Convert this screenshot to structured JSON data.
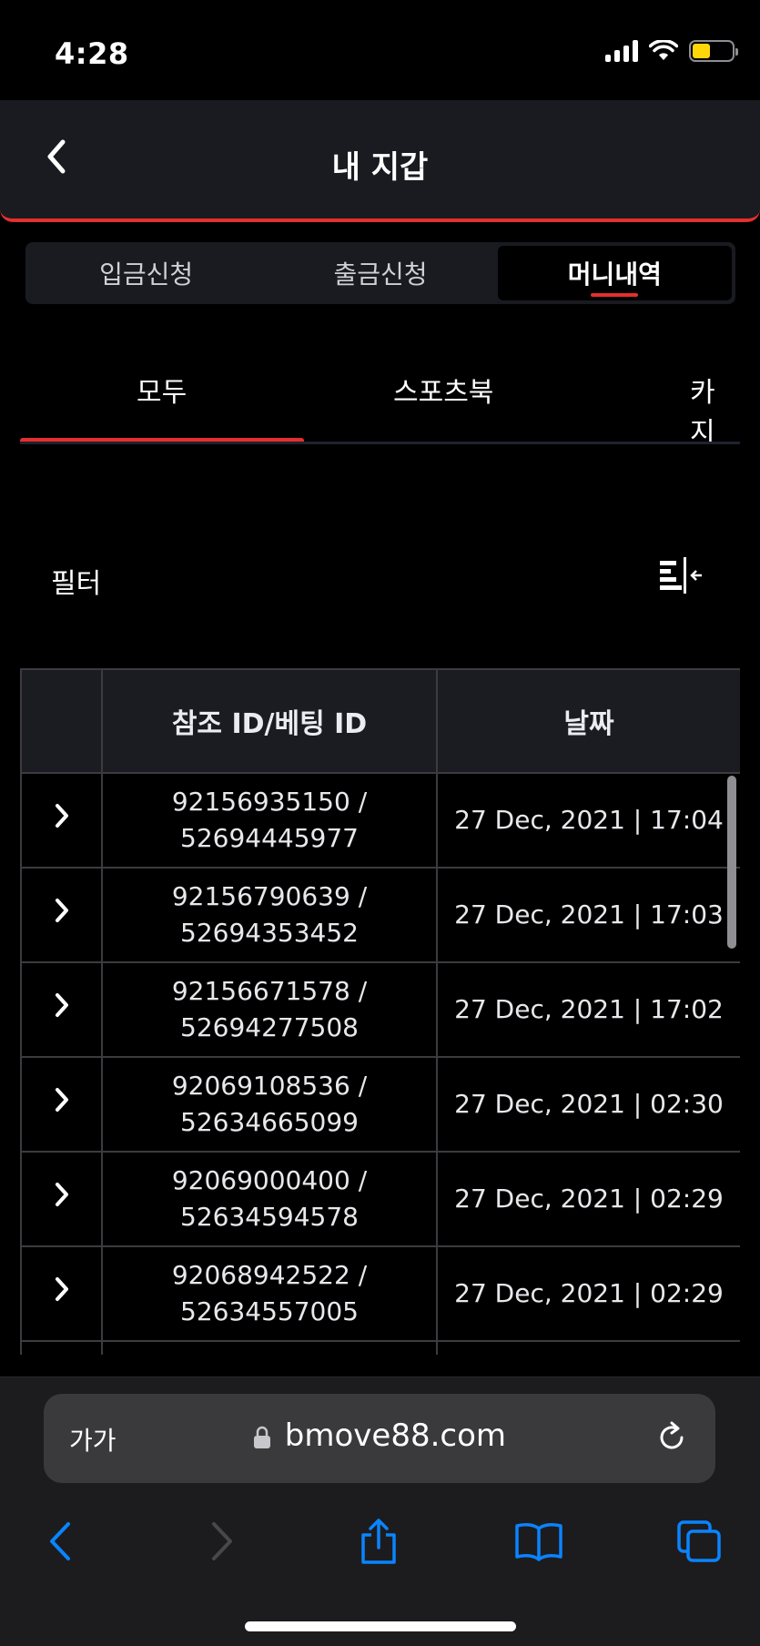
{
  "status_bar": {
    "time": "4:28"
  },
  "header": {
    "title": "내 지갑"
  },
  "seg_tabs": [
    {
      "label": "입금신청"
    },
    {
      "label": "출금신청"
    },
    {
      "label": "머니내역"
    }
  ],
  "cat_tabs": [
    {
      "label": "모두"
    },
    {
      "label": "스포츠북"
    },
    {
      "label": "카지"
    }
  ],
  "filter": {
    "label": "필터"
  },
  "table": {
    "headers": [
      "",
      "참조 ID/베팅 ID",
      "날짜"
    ],
    "rows": [
      {
        "ref": "92156935150 /",
        "bet": "52694445977",
        "date": "27 Dec, 2021 | 17:04"
      },
      {
        "ref": "92156790639 /",
        "bet": "52694353452",
        "date": "27 Dec, 2021 | 17:03"
      },
      {
        "ref": "92156671578 /",
        "bet": "52694277508",
        "date": "27 Dec, 2021 | 17:02"
      },
      {
        "ref": "92069108536 /",
        "bet": "52634665099",
        "date": "27 Dec, 2021 | 02:30"
      },
      {
        "ref": "92069000400 /",
        "bet": "52634594578",
        "date": "27 Dec, 2021 | 02:29"
      },
      {
        "ref": "92068942522 /",
        "bet": "52634557005",
        "date": "27 Dec, 2021 | 02:29"
      }
    ]
  },
  "safari": {
    "aa_label": "가가",
    "url": "bmove88.com"
  },
  "colors": {
    "accent": "#e62e2e",
    "ios_blue": "#0a84ff",
    "battery": "#ffd60a"
  },
  "icons": {
    "back": "chevron-left-icon",
    "filter": "filter-icon",
    "row": "chevron-right-icon",
    "lock": "lock-icon",
    "reload": "reload-icon",
    "share": "share-icon",
    "bookmarks": "book-icon",
    "tabs": "tabs-icon"
  }
}
